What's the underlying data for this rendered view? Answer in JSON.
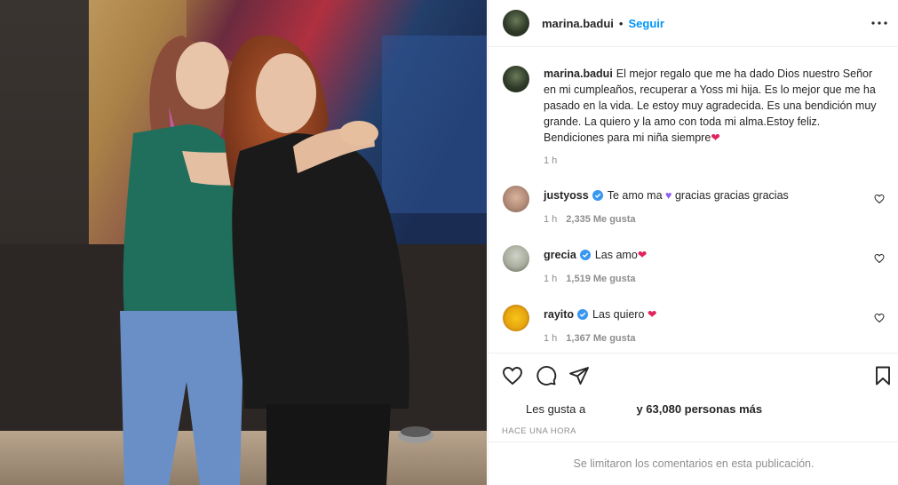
{
  "post": {
    "author": "marina.badui",
    "separator": "•",
    "follow_label": "Seguir",
    "more_icon": "more-horizontal-icon"
  },
  "caption": {
    "username": "marina.badui",
    "text": "El mejor regalo que me ha dado Dios nuestro Señor en mi cumpleaños, recuperar a Yoss mi hija. Es lo mejor que me ha pasado en la vida. Le estoy muy agradecida. Es una bendición muy grande. La quiero y la amo con toda mi alma.Estoy feliz. Bendiciones para mi niña siempre",
    "emoji": "❤",
    "time": "1 h"
  },
  "comments": [
    {
      "username": "justyoss",
      "verified": true,
      "text_a": "Te amo ma",
      "emoji": "💜",
      "text_b": "gracias gracias gracias",
      "time": "1 h",
      "likes": "2,335 Me gusta"
    },
    {
      "username": "grecia",
      "verified": true,
      "text_a": "Las amo",
      "emoji": "❤",
      "text_b": "",
      "time": "1 h",
      "likes": "1,519 Me gusta"
    },
    {
      "username": "rayito",
      "verified": true,
      "text_a": "Las quiero",
      "emoji": "❤",
      "text_b": "",
      "time": "1 h",
      "likes": "1,367 Me gusta"
    }
  ],
  "actions": {
    "icons": [
      "heart-icon",
      "comment-icon",
      "share-icon",
      "bookmark-icon"
    ],
    "likes_prefix": "Les gusta a",
    "likes_suffix": "y 63,080 personas más",
    "timestamp": "HACE UNA HORA"
  },
  "footer": {
    "notice": "Se limitaron los comentarios en esta publicación."
  },
  "colors": {
    "accent": "#0095f6",
    "verified": "#3897f0",
    "muted": "#8e8e8e",
    "heart": "#e0245e"
  }
}
